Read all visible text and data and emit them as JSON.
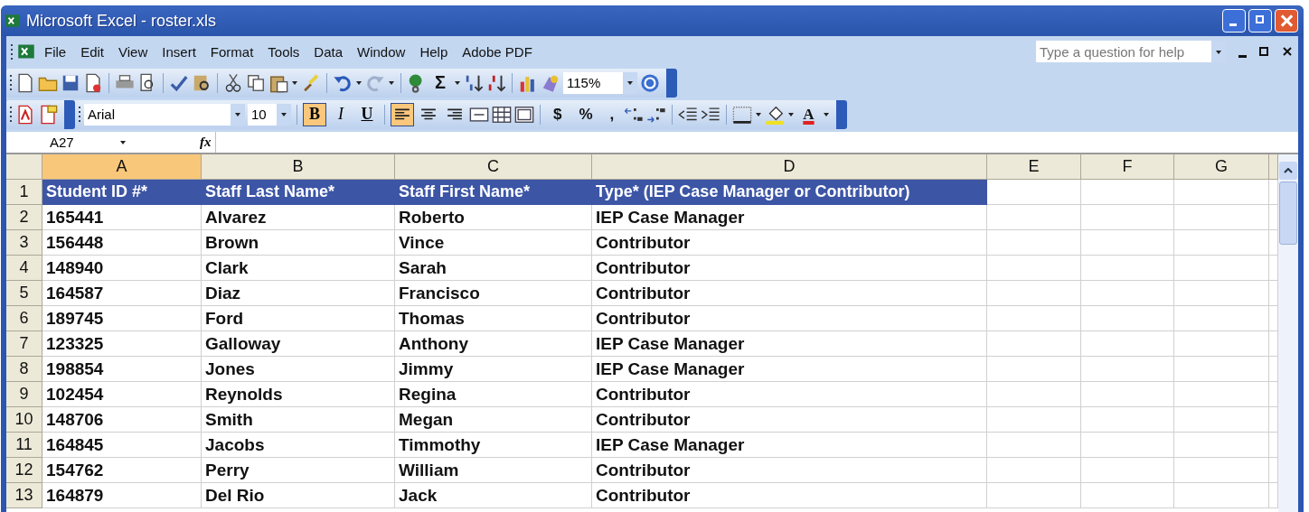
{
  "window": {
    "title": "Microsoft Excel - roster.xls"
  },
  "menu": [
    "File",
    "Edit",
    "View",
    "Insert",
    "Format",
    "Tools",
    "Data",
    "Window",
    "Help",
    "Adobe PDF"
  ],
  "help_box": {
    "placeholder": "Type a question for help"
  },
  "standard_toolbar": {
    "autosum": "Σ",
    "zoom": "115%"
  },
  "formatting_toolbar": {
    "font": "Arial",
    "size": "10",
    "style_buttons": [
      {
        "label": "B",
        "selected": true
      },
      {
        "label": "I",
        "selected": false
      },
      {
        "label": "U",
        "selected": false
      }
    ],
    "alignment": [
      {
        "selected": true
      },
      {
        "selected": false
      },
      {
        "selected": false
      }
    ],
    "number_buttons": [
      "$",
      "%",
      ","
    ],
    "font_color": "A"
  },
  "name_box": "A27",
  "formula_label": "fx",
  "columns": [
    {
      "label": "A",
      "selected": true
    },
    {
      "label": "B",
      "selected": false
    },
    {
      "label": "C",
      "selected": false
    },
    {
      "label": "D",
      "selected": false
    },
    {
      "label": "E",
      "selected": false
    },
    {
      "label": "F",
      "selected": false
    },
    {
      "label": "G",
      "selected": false
    }
  ],
  "rows": [
    {
      "number": "1",
      "kind": "header",
      "cells": [
        "Student ID #*",
        "Staff Last Name*",
        "Staff First Name*",
        "Type* (IEP Case Manager or Contributor)"
      ]
    },
    {
      "number": "2",
      "kind": "data",
      "cells": [
        "165441",
        "Alvarez",
        "Roberto",
        "IEP Case Manager"
      ]
    },
    {
      "number": "3",
      "kind": "data",
      "cells": [
        "156448",
        "Brown",
        "Vince",
        "Contributor"
      ]
    },
    {
      "number": "4",
      "kind": "data",
      "cells": [
        "148940",
        "Clark",
        "Sarah",
        "Contributor"
      ]
    },
    {
      "number": "5",
      "kind": "data",
      "cells": [
        "164587",
        "Diaz",
        "Francisco",
        "Contributor"
      ]
    },
    {
      "number": "6",
      "kind": "data",
      "cells": [
        "189745",
        "Ford",
        "Thomas",
        "Contributor"
      ]
    },
    {
      "number": "7",
      "kind": "data",
      "cells": [
        "123325",
        "Galloway",
        "Anthony",
        "IEP Case Manager"
      ]
    },
    {
      "number": "8",
      "kind": "data",
      "cells": [
        "198854",
        "Jones",
        "Jimmy",
        "IEP Case Manager"
      ]
    },
    {
      "number": "9",
      "kind": "data",
      "cells": [
        "102454",
        "Reynolds",
        "Regina",
        "Contributor"
      ]
    },
    {
      "number": "10",
      "kind": "data",
      "cells": [
        "148706",
        "Smith",
        "Megan",
        "Contributor"
      ]
    },
    {
      "number": "11",
      "kind": "data",
      "cells": [
        "164845",
        "Jacobs",
        "Timmothy",
        "IEP Case Manager"
      ]
    },
    {
      "number": "12",
      "kind": "data",
      "cells": [
        "154762",
        "Perry",
        "William",
        "Contributor"
      ]
    },
    {
      "number": "13",
      "kind": "data",
      "cells": [
        "164879",
        "Del Rio",
        "Jack",
        "Contributor"
      ]
    }
  ]
}
